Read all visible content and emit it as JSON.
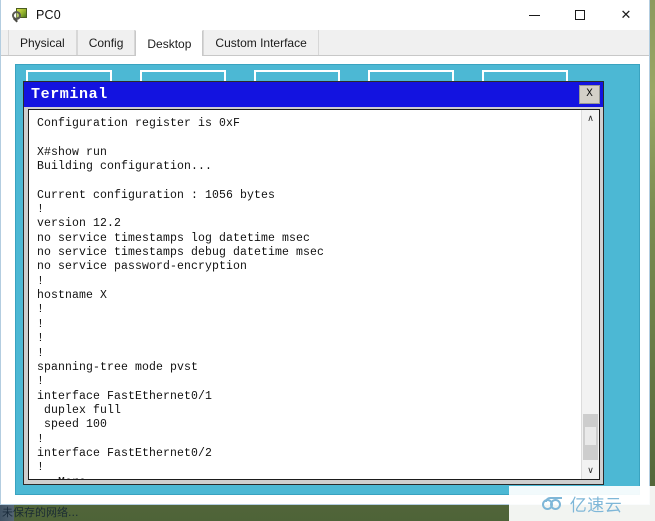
{
  "window": {
    "title": "PC0",
    "icon": "pc-device-icon",
    "controls": {
      "minimize": "minimize-button",
      "maximize": "maximize-button",
      "close_glyph": "✕"
    }
  },
  "tabs": [
    {
      "label": "Physical",
      "active": false
    },
    {
      "label": "Config",
      "active": false
    },
    {
      "label": "Desktop",
      "active": true
    },
    {
      "label": "Custom Interface",
      "active": false
    }
  ],
  "desktop": {
    "background_color": "#4cb8d4",
    "icon_placeholders": 5
  },
  "terminal": {
    "title": "Terminal",
    "close_label": "X",
    "titlebar_color": "#1313e0",
    "text": "Configuration register is 0xF\n\nX#show run\nBuilding configuration...\n\nCurrent configuration : 1056 bytes\n!\nversion 12.2\nno service timestamps log datetime msec\nno service timestamps debug datetime msec\nno service password-encryption\n!\nhostname X\n!\n!\n!\n!\nspanning-tree mode pvst\n!\ninterface FastEthernet0/1\n duplex full\n speed 100\n!\ninterface FastEthernet0/2\n!\n --More--",
    "scrollbar": {
      "up_arrow": "∧",
      "down_arrow": "∨"
    }
  },
  "taskbar": {
    "text": "未保存的网络..."
  },
  "watermark": {
    "text": "亿速云",
    "color": "#7fb7d8"
  }
}
